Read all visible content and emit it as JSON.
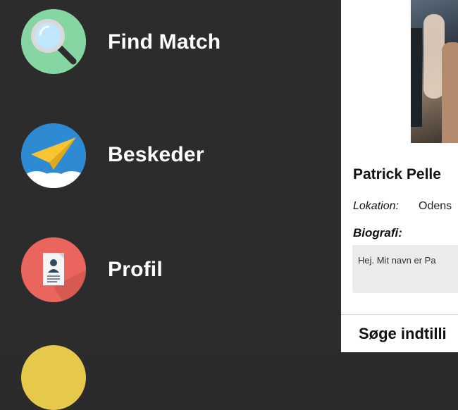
{
  "menu": {
    "items": [
      {
        "label": "Find Match",
        "icon": "magnifier-icon",
        "color": "#86d6a4"
      },
      {
        "label": "Beskeder",
        "icon": "paper-plane-icon",
        "color": "#2e8bd3"
      },
      {
        "label": "Profil",
        "icon": "profile-document-icon",
        "color": "#e9655d"
      }
    ]
  },
  "profile": {
    "name": "Patrick Pelle",
    "location_label": "Lokation:",
    "location_value": "Odens",
    "bio_label": "Biografi:",
    "bio_text": "Hej. Mit navn er Pa",
    "search_settings_title": "Søge indtilli"
  }
}
